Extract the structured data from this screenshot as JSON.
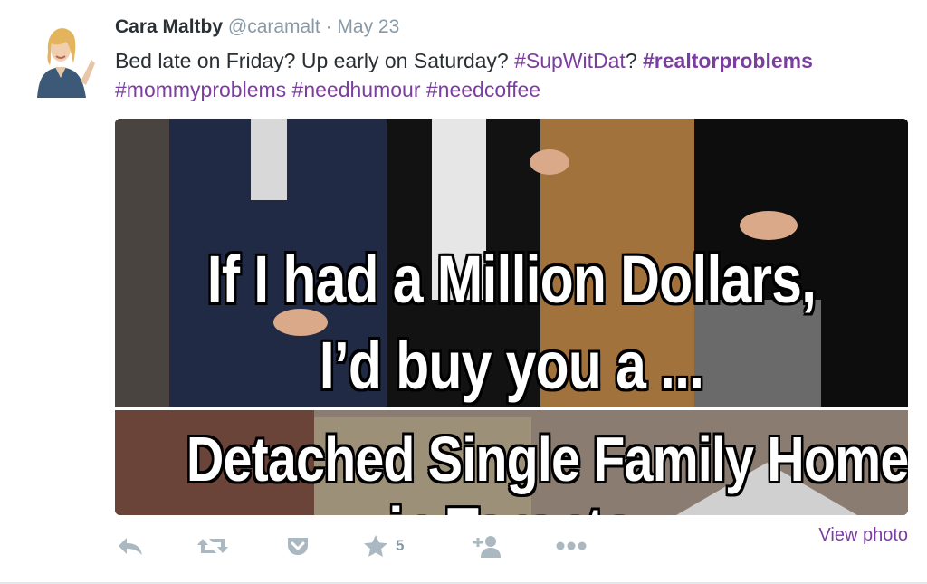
{
  "tweet": {
    "author_name": "Cara Maltby",
    "handle": "@caramalt",
    "separator": " · ",
    "date": "May 23",
    "text_prefix": "Bed late on Friday? Up early on Saturday? ",
    "tag1": "#SupWitDat",
    "text_mid": "? ",
    "tag2": "#realtorproblems",
    "tag3": "#mommyproblems",
    "tag4": "#needhumour",
    "tag5": "#needcoffee"
  },
  "media": {
    "line1": "If I had a Million Dollars,",
    "line2": "I’d buy you a ...",
    "line3": "Detached Single Family Home",
    "line4": "in Toronto"
  },
  "actions": {
    "favorite_count": "5",
    "view_photo": "View photo"
  },
  "colors": {
    "accent": "#7b3ea0",
    "name": "#292f33",
    "meta": "#8899a6",
    "icon": "#aab8c2"
  }
}
